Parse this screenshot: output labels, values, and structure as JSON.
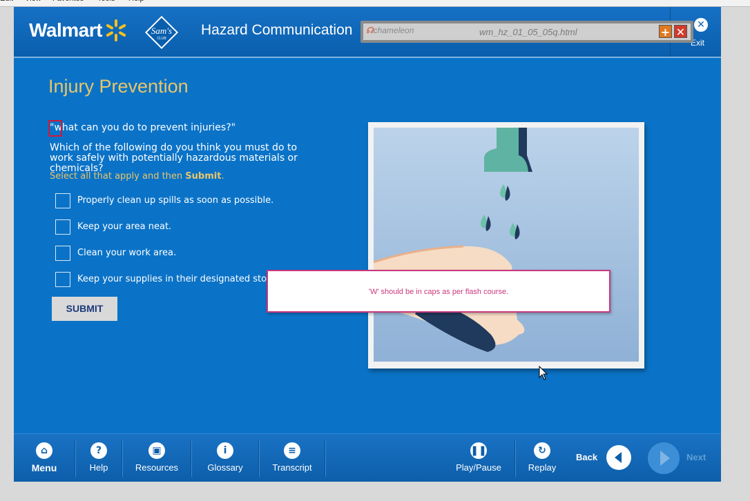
{
  "header": {
    "walmart_logo": "Walmart",
    "sams_logo": "Sam's",
    "sams_logo_sub": "CLUB",
    "course_title": "Hazard Communication",
    "exit_label": "Exit"
  },
  "chameleon": {
    "brand": "chameleon",
    "file_name": "wm_hz_01_05_05q.html"
  },
  "content": {
    "title": "Injury Prevention",
    "quote": "\"what can you do to prevent injuries?\"",
    "question": "Which of the following do you think you must do to work safely with potentially hazardous materials or chemicals?",
    "instruction_prefix": "Select all that apply and then ",
    "instruction_action": "Submit",
    "instruction_suffix": ".",
    "options": [
      {
        "label": "Properly clean up spills as soon as possible.",
        "checked": false
      },
      {
        "label": "Keep your area neat.",
        "checked": false
      },
      {
        "label": "Clean your work area.",
        "checked": false
      },
      {
        "label": "Keep your supplies in their designated storage",
        "checked": false
      }
    ],
    "submit_label": "SUBMIT"
  },
  "review_comment": {
    "text": "'W' should be in caps as per flash course."
  },
  "footer": {
    "left": [
      {
        "label": "Menu",
        "icon": "home-icon"
      },
      {
        "label": "Help",
        "icon": "question-icon"
      },
      {
        "label": "Resources",
        "icon": "document-icon"
      },
      {
        "label": "Glossary",
        "icon": "info-icon"
      },
      {
        "label": "Transcript",
        "icon": "list-icon"
      }
    ],
    "right": [
      {
        "label": "Play/Pause",
        "icon": "pause-icon"
      },
      {
        "label": "Replay",
        "icon": "replay-icon"
      }
    ],
    "back_label": "Back",
    "next_label": "Next"
  },
  "colors": {
    "stage_bg": "#0b73c7",
    "title_gold": "#e8c56a",
    "comment_pink": "#c9377f"
  }
}
